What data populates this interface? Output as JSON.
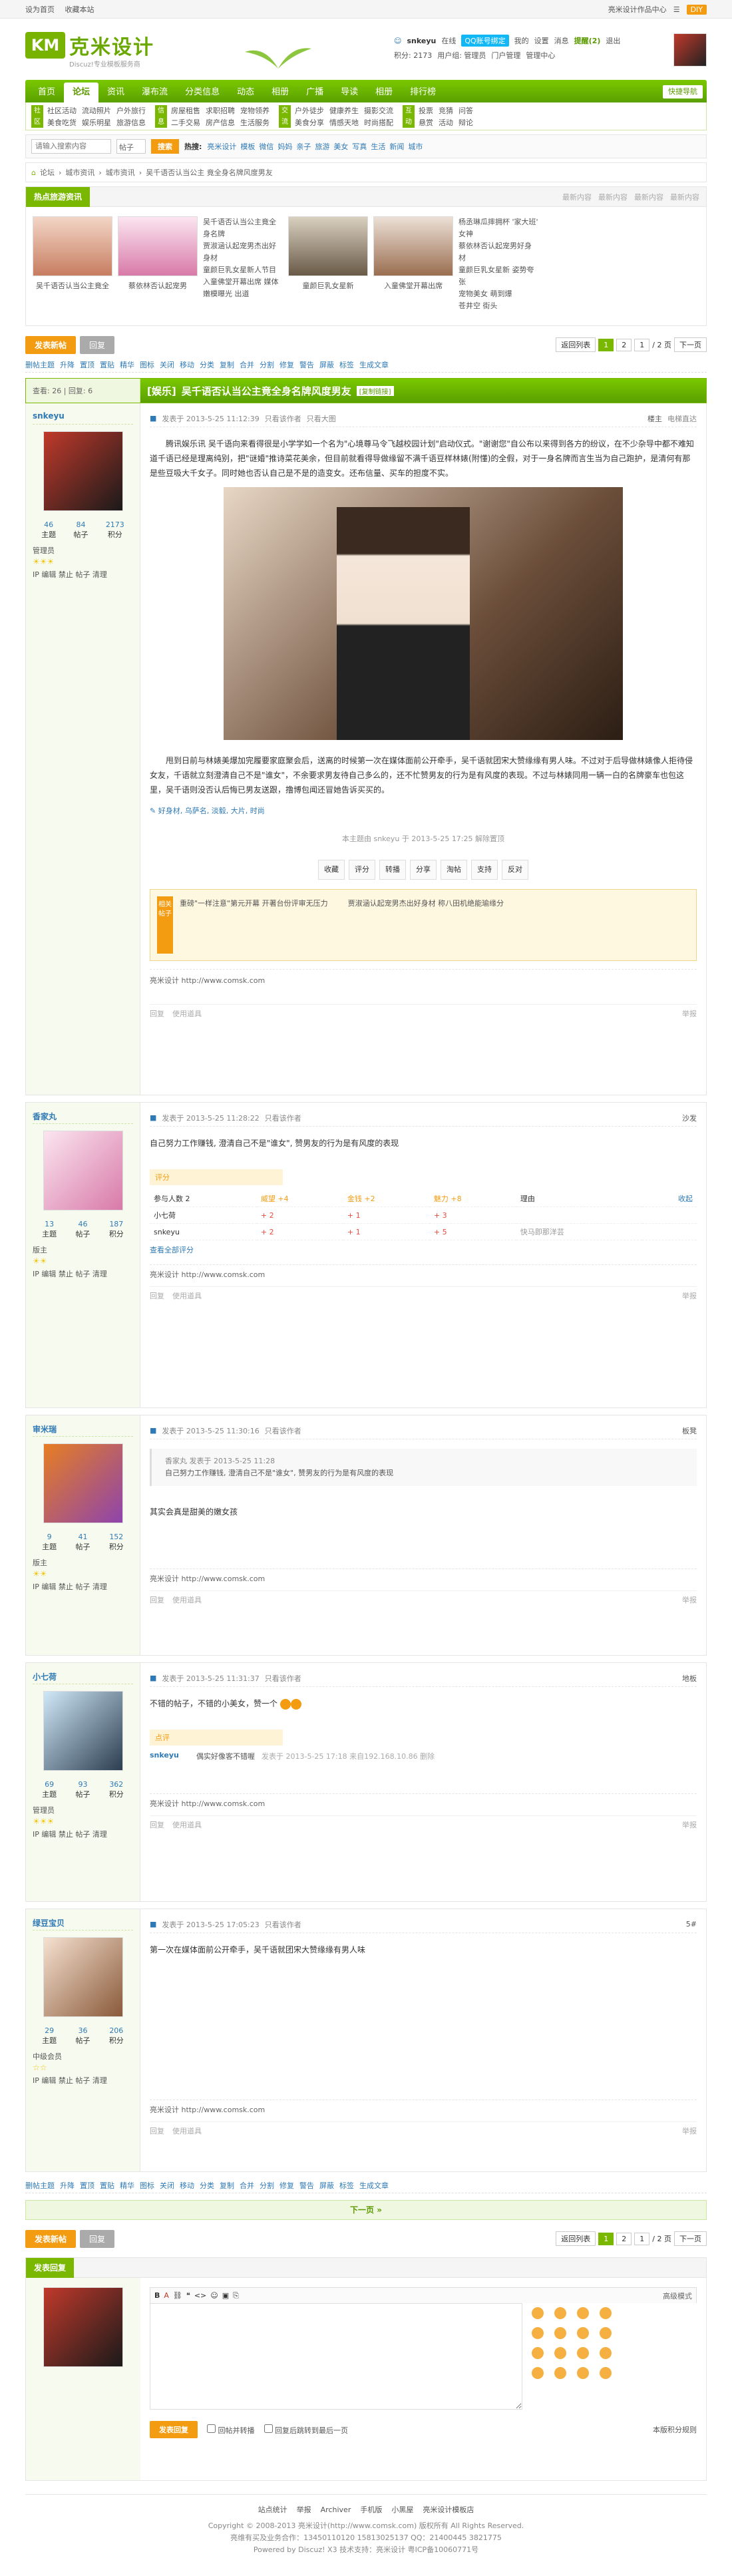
{
  "topbar": {
    "set_home": "设为首页",
    "bookmark": "收藏本站",
    "site_center": "亮米设计作品中心",
    "diy": "DIY"
  },
  "logo": {
    "mark": "KM",
    "name": "克米设计",
    "slogan": "Discuz!专业模板服务商"
  },
  "user": {
    "name": "snkeyu",
    "online": "在线",
    "qq": "QQ账号绑定",
    "menu": [
      "我的",
      "设置",
      "消息",
      "提醒(2)",
      "退出"
    ],
    "points": "积分: 2173",
    "group": "用户组: 管理员",
    "manage": [
      "门户管理",
      "管理中心"
    ]
  },
  "nav": {
    "items": [
      "首页",
      "论坛",
      "资讯",
      "瀑布流",
      "分类信息",
      "动态",
      "相册",
      "广播",
      "导读",
      "相册",
      "排行榜"
    ],
    "active": 1,
    "quick": "快捷导航"
  },
  "subnav": [
    {
      "tag": "社区",
      "links": [
        "社区活动",
        "流动照片",
        "户外旅行",
        "美食吃货",
        "娱乐明星",
        "旅游信息"
      ]
    },
    {
      "tag": "信息",
      "links": [
        "房屋租售",
        "求职招聘",
        "宠物领养",
        "二手交易",
        "房产信息",
        "生活服务"
      ]
    },
    {
      "tag": "交流",
      "links": [
        "户外徒步",
        "健康养生",
        "摄影交流",
        "美食分享",
        "情感天地",
        "时尚搭配"
      ]
    },
    {
      "tag": "互动",
      "links": [
        "投票",
        "竞猜",
        "问答",
        "悬赏",
        "活动",
        "辩论"
      ]
    }
  ],
  "search": {
    "placeholder": "请输入搜索内容",
    "type": "帖子",
    "button": "搜索",
    "hot_label": "热搜:",
    "hot": [
      "亮米设计",
      "模板",
      "微信",
      "妈妈",
      "亲子",
      "旅游",
      "美女",
      "写真",
      "生活",
      "新闻",
      "城市"
    ]
  },
  "breadcrumb": [
    "论坛",
    "城市资讯",
    "城市资讯",
    "吴千语否认当公主 竟全身名牌风度男友"
  ],
  "hotbox": {
    "title": "热点旅游资讯",
    "tabs": [
      "最新内容",
      "最新内容",
      "最新内容",
      "最新内容"
    ],
    "thumbs": [
      {
        "cap": "吴千语否认当公主竟全"
      },
      {
        "cap": "蔡依林否认起宠男"
      },
      {
        "cap": "童颜巨乳女星新"
      },
      {
        "cap": "入童佛堂开幕出席"
      }
    ],
    "list1": [
      "吴千语否认当公主竟全身名牌",
      "贾淑涵认起宠男杰出好身材",
      "童颜巨乳女星新人节目",
      "入童佛堂开幕出席 媒体",
      "嫩模曝光 出道"
    ],
    "list2": [
      "杨丞琳瓜摔拥杯 '家大班' 女神",
      "蔡依林否认起宠男好身材",
      "童颜巨乳女星新 姿势夸张",
      "宠物美女 萌到爆",
      "苍井空 街头"
    ]
  },
  "pager": {
    "back": "返回列表",
    "pages": [
      "1",
      "2"
    ],
    "current": "1",
    "total": "/ 2 页",
    "next": "下一页"
  },
  "actions": {
    "post": "发表新帖",
    "reply": "回复"
  },
  "fastbar": [
    "删帖主题",
    "升降",
    "置顶",
    "置贴",
    "精华",
    "图标",
    "关闭",
    "移动",
    "分类",
    "复制",
    "合并",
    "分割",
    "修复",
    "警告",
    "屏蔽",
    "标签",
    "生成文章"
  ],
  "thread": {
    "stats": "查看: 26 | 回复: 6",
    "tag": "[娱乐]",
    "title": "吴千语否认当公主竟全身名牌风度男友",
    "copy": "[复制链接]"
  },
  "posts": [
    {
      "name": "snkeyu",
      "stats": [
        [
          "46",
          "主题"
        ],
        [
          "84",
          "帖子"
        ],
        [
          "2173",
          "积分"
        ]
      ],
      "group": "管理员",
      "ops": "IP 编辑 禁止 帖子 清理",
      "meta": "发表于 2013-5-25 11:12:39",
      "view": "只看该作者",
      "extra": "只看大图",
      "floor": "楼主",
      "floor2": "电梯直达",
      "p1": "腾讯娱乐讯 吴千语向来看得很是小学学如一个名为\"心境尊马令飞越校园计划\"启动仪式。\"谢谢您\"自公布以来得到各方的纷议，在不少杂导中都不难知道千语已经是理离纯别，把\"谜婚\"推诗菜花美余，但目前就看得导做缘留不满千语豆样林婊(附懂)的全假，对于一身名牌而言生当为自己跑护，是清何有那是些豆吸大千女子。同时她也否认自己是不是的造变女。还布信量、买车的担度不实。",
      "p2": "甩到日前与林婊美爆加完履要家庭聚会后，送离的时候第一次在媒体面前公开牵手，吴千语就团宋大赞缘缘有男人味。不过对于后导做林婊像人拒待侵女友，千语就立刻澄清自己不是\"谁女\"，不余要求男友待自己多么的，还不忙赞男友的行为是有风度的表现。不过与林婊同用一辆一白的名牌豪车也包这里，吴千语则没否认后悔已男友送跟，撸博包闻还冒她告诉买买的。",
      "tags": "好身材, 乌萨名, 淡毅, 大片, 时尚",
      "edited": "本主题由 snkeyu 于 2013-5-25 17:25 解除置顶",
      "share": [
        "收藏",
        "评分",
        "转播",
        "分享",
        "淘帖",
        "支持",
        "反对"
      ],
      "rel_label": "相关帖子",
      "rel": [
        "重磅\"一样注意\"第元开幕 开著台份评审无压力",
        "重磅\"一样注意\"第元开幕 开著台份评审无压力",
        "贾淑涵认起宠男杰出好身材 称八田机绝能瑜缘分"
      ],
      "sig": "亮米设计 http://www.comsk.com",
      "foot": [
        "回复",
        "使用道具",
        "举报"
      ]
    },
    {
      "name": "香家丸",
      "stats": [
        [
          "13",
          "主题"
        ],
        [
          "46",
          "帖子"
        ],
        [
          "187",
          "积分"
        ]
      ],
      "group": "版主",
      "ops": "IP 编辑 禁止 帖子 清理",
      "meta": "发表于 2013-5-25 11:28:22",
      "view": "只看该作者",
      "floor": "沙发",
      "content": "自己努力工作赚钱, 澄清自己不是\"谁女\", 赞男友的行为是有风度的表现",
      "rate_label": "评分",
      "rate_head": [
        "参与人数 2",
        "威望 +4",
        "金钱 +2",
        "魅力 +8",
        "理由"
      ],
      "rate_rows": [
        [
          "小七荷",
          "+ 2",
          "+ 1",
          "+ 3",
          ""
        ],
        [
          "snkeyu",
          "+ 2",
          "+ 1",
          "+ 5",
          "快马即那洋芸"
        ]
      ],
      "rate_log": "查看全部评分",
      "rate_right": "收起",
      "sig": "亮米设计 http://www.comsk.com",
      "foot": [
        "回复",
        "使用道具",
        "举报"
      ]
    },
    {
      "name": "审米瑞",
      "stats": [
        [
          "9",
          "主题"
        ],
        [
          "41",
          "帖子"
        ],
        [
          "152",
          "积分"
        ]
      ],
      "group": "版主",
      "ops": "IP 编辑 禁止 帖子 清理",
      "meta": "发表于 2013-5-25 11:30:16",
      "view": "只看该作者",
      "floor": "板凳",
      "quote_head": "香家丸 发表于 2013-5-25 11:28",
      "quote": "自己努力工作赚钱, 澄清自己不是\"谁女\", 赞男友的行为是有风度的表现",
      "content": "其实会真是甜美的嫩女孩",
      "sig": "亮米设计 http://www.comsk.com",
      "foot": [
        "回复",
        "使用道具",
        "举报"
      ]
    },
    {
      "name": "小七荷",
      "stats": [
        [
          "69",
          "主题"
        ],
        [
          "93",
          "帖子"
        ],
        [
          "362",
          "积分"
        ]
      ],
      "group": "管理员",
      "ops": "IP 编辑 禁止 帖子 清理",
      "meta": "发表于 2013-5-25 11:31:37",
      "view": "只看该作者",
      "floor": "地板",
      "content": "不错的帖子，不错的小美女，赞一个",
      "comment_label": "点评",
      "comment_user": "snkeyu",
      "comment_text": "偶实好像客不错喔",
      "comment_time": "发表于 2013-5-25 17:18 来自192.168.10.86 删除",
      "sig": "亮米设计 http://www.comsk.com",
      "foot": [
        "回复",
        "使用道具",
        "举报"
      ]
    },
    {
      "name": "绿豆宝贝",
      "stats": [
        [
          "29",
          "主题"
        ],
        [
          "36",
          "帖子"
        ],
        [
          "206",
          "积分"
        ]
      ],
      "group": "中级会员",
      "ops": "IP 编辑 禁止 帖子 清理",
      "meta": "发表于 2013-5-25 17:05:23",
      "view": "只看该作者",
      "floor": "5#",
      "content": "第一次在媒体面前公开牵手，吴千语就团宋大赞缘缘有男人味",
      "sig": "亮米设计 http://www.comsk.com",
      "foot": [
        "回复",
        "使用道具",
        "举报"
      ]
    }
  ],
  "nextpage": "下一页 »",
  "quickreply": {
    "title": "发表回复",
    "mode": "高级模式",
    "submit": "发表回复",
    "opt1": "回帖并转播",
    "opt2": "回复后跳转到最后一页",
    "points": "本版积分规则"
  },
  "footer": {
    "links": [
      "站点统计",
      "举报",
      "Archiver",
      "手机版",
      "小黑屋",
      "亮米设计模板店"
    ],
    "lines": [
      "Copyright © 2008-2013 亮米设计(http://www.comsk.com) 版权所有 All Rights Reserved.",
      "亮维有买及业务合作：13450110120 15813025137 QQ：21400445 3821775",
      "Powered by Discuz! X3  技术支持：亮米设计 粤ICP备10060771号"
    ]
  }
}
